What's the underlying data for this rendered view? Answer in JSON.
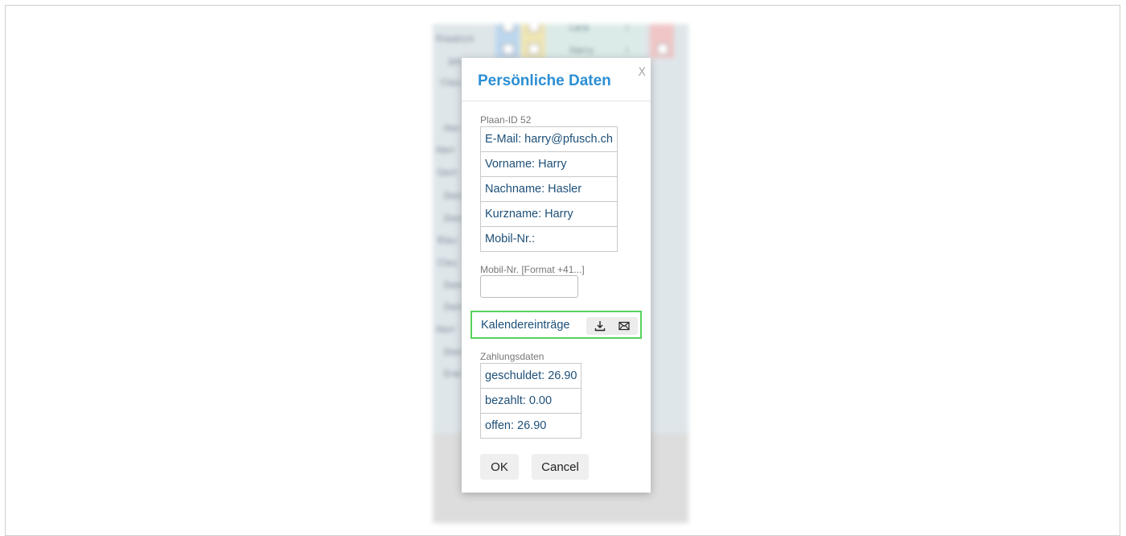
{
  "background": {
    "names": [
      "Friedrich",
      "Jeh",
      "Clau",
      "Her",
      "Herr",
      "Gert",
      "Den",
      "Den",
      "Klau",
      "Clau",
      "Den",
      "Den",
      "Herr",
      "Den",
      "Erw"
    ],
    "rows": [
      {
        "name": "Lara",
        "mark": "i"
      },
      {
        "name": "Harry",
        "mark": "i"
      }
    ]
  },
  "dialog": {
    "title": "Persönliche Daten",
    "close": "X",
    "plaan_id": "Plaan-ID 52",
    "personal_fields": [
      "E-Mail: harry@pfusch.ch",
      "Vorname: Harry",
      "Nachname: Hasler",
      "Kurzname: Harry",
      "Mobil-Nr.:"
    ],
    "mobile": {
      "label": "Mobil-Nr. [Format +41...]",
      "value": "",
      "placeholder": ""
    },
    "calendar": {
      "label": "Kalendereinträge",
      "download_icon": "download-icon",
      "mail_icon": "mail-icon"
    },
    "payment": {
      "label": "Zahlungsdaten",
      "fields": [
        "geschuldet: 26.90",
        "bezahlt: 0.00",
        "offen: 26.90"
      ]
    },
    "buttons": {
      "ok": "OK",
      "cancel": "Cancel"
    }
  },
  "colors": {
    "title": "#2b8fd4",
    "text": "#1d4f78",
    "highlight_border": "#58d25a"
  }
}
